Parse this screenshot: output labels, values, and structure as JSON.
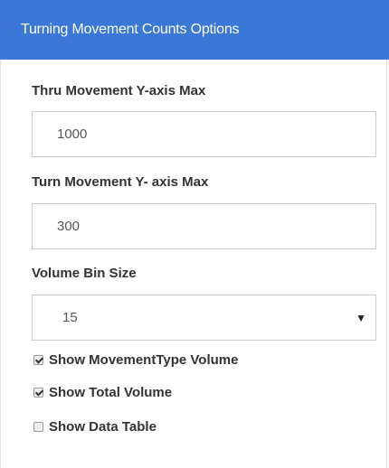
{
  "header": {
    "title": "Turning Movement Counts Options"
  },
  "fields": {
    "thru_max": {
      "label": "Thru Movement Y-axis Max",
      "value": "1000"
    },
    "turn_max": {
      "label": "Turn Movement Y- axis Max",
      "value": "300"
    },
    "bin_size": {
      "label": "Volume Bin Size",
      "selected": "15"
    }
  },
  "checkboxes": [
    {
      "label": "Show MovementType Volume",
      "checked": true
    },
    {
      "label": "Show Total Volume",
      "checked": true
    },
    {
      "label": "Show Data Table",
      "checked": false
    }
  ]
}
